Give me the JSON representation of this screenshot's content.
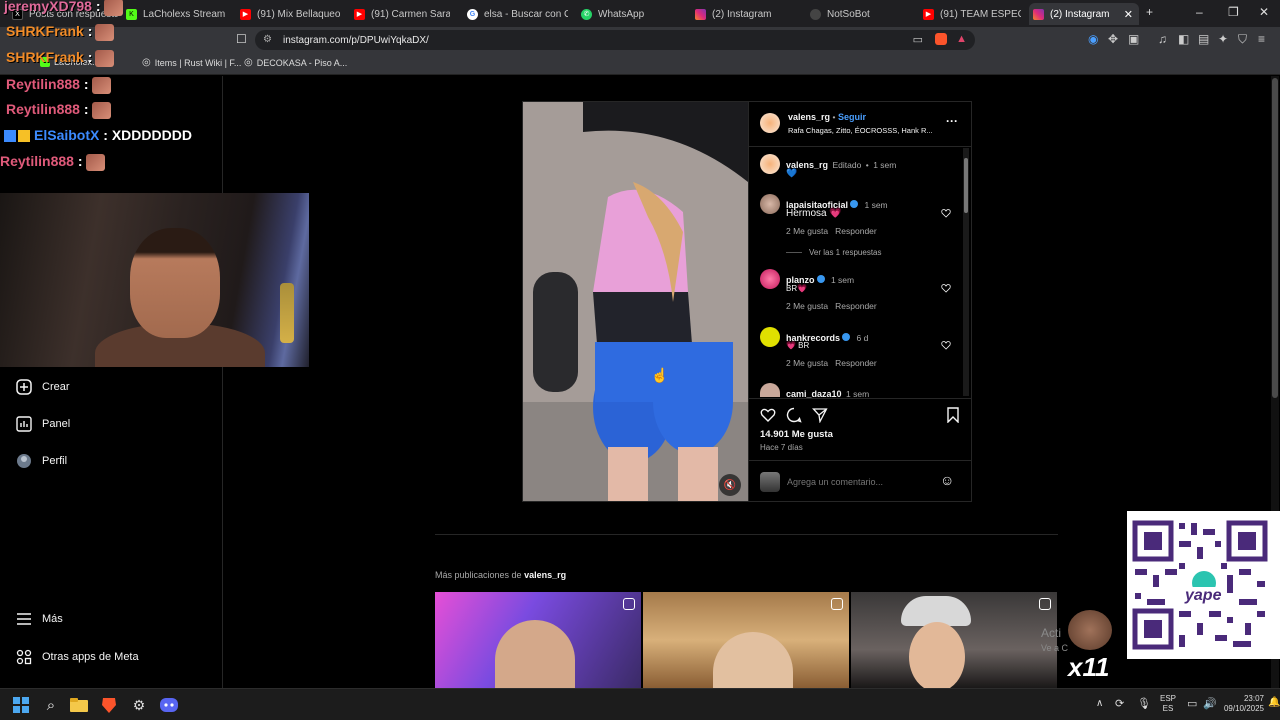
{
  "browser": {
    "tabs": [
      {
        "label": "Posts con respuestas",
        "active": false
      },
      {
        "label": "LaCholexs Stream - W",
        "active": false
      },
      {
        "label": "(91) Mix Bellaqueo",
        "active": false
      },
      {
        "label": "(91) Carmen Sarah",
        "active": false
      },
      {
        "label": "elsa - Buscar con Goog",
        "active": false
      },
      {
        "label": "WhatsApp",
        "active": false
      },
      {
        "label": "(2) Instagram",
        "active": false
      },
      {
        "label": "NotSoBot",
        "active": false
      },
      {
        "label": "(91) TEAM ESPECIALES",
        "active": false
      },
      {
        "label": "(2) Instagram",
        "active": true
      }
    ],
    "new_tab_symbol": "+",
    "url": "instagram.com/p/DPUwiYqkaDX/",
    "bookmarks": [
      {
        "label": "LaCholex..."
      },
      {
        "label": "Items | Rust Wiki | F..."
      },
      {
        "label": "DECOKASA - Piso A..."
      }
    ]
  },
  "chat_overlay": [
    {
      "user": "jeremyXD798",
      "sep": ":",
      "msg": "",
      "color": "#e06a9a"
    },
    {
      "user": "SHRKFrank",
      "sep": ":",
      "msg": "",
      "color": "#f28c28"
    },
    {
      "user": "SHRKFrank",
      "sep": ":",
      "msg": "",
      "color": "#f28c28"
    },
    {
      "user": "Reytilin888",
      "sep": ":",
      "msg": "",
      "color": "#e05a7a"
    },
    {
      "user": "Reytilin888",
      "sep": ":",
      "msg": "",
      "color": "#e05a7a"
    },
    {
      "user": "ElSaibotX",
      "sep": ":",
      "msg": "XDDDDDDD",
      "color": "#3c8bff"
    },
    {
      "user": "Reytilin888",
      "sep": ":",
      "msg": "",
      "color": "#e05a7a"
    }
  ],
  "sidebar": {
    "items": [
      {
        "label": "Crear",
        "icon": "plus-square-icon"
      },
      {
        "label": "Panel",
        "icon": "chart-icon"
      },
      {
        "label": "Perfil",
        "icon": "profile-icon"
      },
      {
        "label": "Más",
        "icon": "menu-icon"
      },
      {
        "label": "Otras apps de Meta",
        "icon": "meta-apps-icon"
      }
    ]
  },
  "post": {
    "author": "valens_rg",
    "follow_label": "Seguir",
    "follow_sep": "•",
    "audio_credits": "Rafa Chagas, Zitto, ÉOCROSSS, Hank R...",
    "caption": {
      "user": "valens_rg",
      "edited": "Editado",
      "sep": "•",
      "time": "1 sem",
      "text": "💙"
    },
    "comments": [
      {
        "user": "lapaisitaoficial",
        "verified": true,
        "time": "1 sem",
        "text": "Hermosa 💗",
        "likes": "2 Me gusta",
        "reply": "Responder",
        "view_replies": "Ver las 1 respuestas"
      },
      {
        "user": "planzo",
        "verified": true,
        "time": "1 sem",
        "text": "BR💗",
        "likes": "2 Me gusta",
        "reply": "Responder"
      },
      {
        "user": "hankrecords",
        "verified": true,
        "time": "6 d",
        "text": "💗 BR",
        "likes": "2 Me gusta",
        "reply": "Responder"
      },
      {
        "user": "cami_daza10",
        "verified": false,
        "time": "1 sem",
        "text": ""
      }
    ],
    "likes": "14.901 Me gusta",
    "posted": "Hace 7 días",
    "comment_placeholder": "Agrega un comentario...",
    "muted": true
  },
  "more_posts": {
    "prefix": "Más publicaciones de",
    "user": "valens_rg"
  },
  "stream_overlay": {
    "activate_fragment": "Acti",
    "activate_fragment2": "Ve a C",
    "multiplier": "x11",
    "qr_brand": "yape"
  },
  "taskbar": {
    "lang_top": "ESP",
    "lang_bottom": "ES",
    "time": "23:07",
    "date": "09/10/2025"
  }
}
